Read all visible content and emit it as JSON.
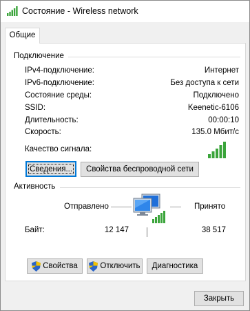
{
  "window": {
    "title": "Состояние - Wireless network"
  },
  "tabs": [
    {
      "label": "Общие"
    }
  ],
  "connection": {
    "heading": "Подключение",
    "rows": [
      {
        "label": "IPv4-подключение:",
        "value": "Интернет"
      },
      {
        "label": "IPv6-подключение:",
        "value": "Без доступа к сети"
      },
      {
        "label": "Состояние среды:",
        "value": "Подключено"
      },
      {
        "label": "SSID:",
        "value": "Keenetic-6106"
      },
      {
        "label": "Длительность:",
        "value": "00:00:10"
      },
      {
        "label": "Скорость:",
        "value": "135.0 Мбит/с"
      }
    ],
    "signal_label": "Качество сигнала:",
    "signal_bars": 5,
    "details_button": "Сведения...",
    "wireless_props_button": "Свойства беспроводной сети"
  },
  "activity": {
    "heading": "Активность",
    "sent_label": "Отправлено",
    "received_label": "Принято",
    "bytes_label": "Байт:",
    "bytes_sent": "12 147",
    "bytes_received": "38 517"
  },
  "actions": {
    "properties": "Свойства",
    "disable": "Отключить",
    "diagnose": "Диагностика"
  },
  "footer": {
    "close": "Закрыть"
  },
  "colors": {
    "signal_green": "#3aa43a",
    "focus_blue": "#0078d7",
    "shield_blue": "#2a65c7",
    "shield_yellow": "#f2c200"
  }
}
